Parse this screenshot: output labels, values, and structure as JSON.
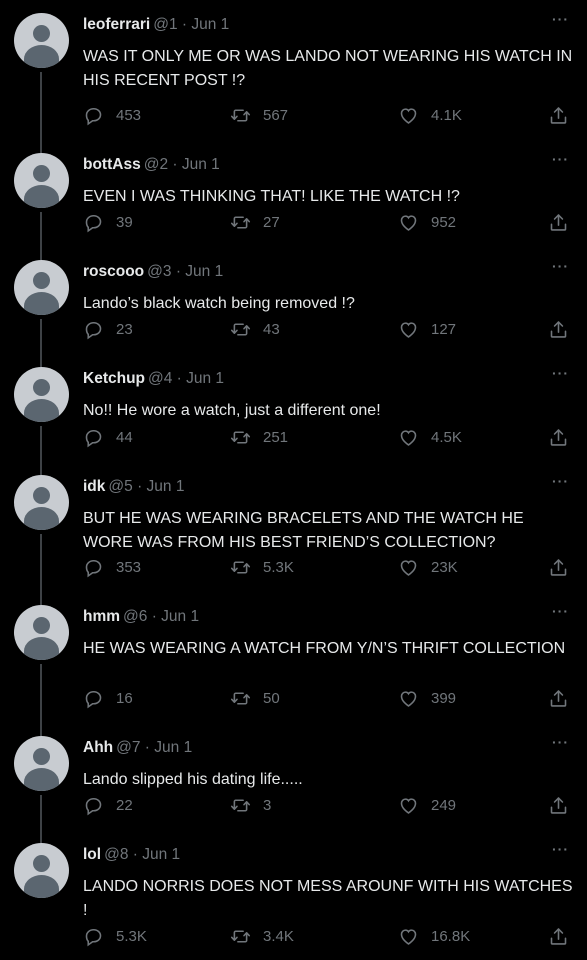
{
  "tweets": [
    {
      "name": "leoferrari",
      "meta": "@1 · Jun 1",
      "more": "···",
      "text": "WAS IT ONLY ME OR WAS LANDO NOT WEARING HIS WATCH IN HIS RECENT POST !?",
      "replies": "453",
      "retweets": "567",
      "likes": "4.1K"
    },
    {
      "name": "bottAss",
      "meta": "@2 · Jun 1",
      "more": "···",
      "text": "EVEN I WAS THINKING THAT! LIKE THE WATCH !?",
      "replies": "39",
      "retweets": "27",
      "likes": "952"
    },
    {
      "name": "roscooo",
      "meta": "@3 · Jun 1",
      "more": "···",
      "text": "Lando’s black watch being removed !?",
      "replies": "23",
      "retweets": "43",
      "likes": "127"
    },
    {
      "name": "Ketchup",
      "meta": "@4 · Jun 1",
      "more": "···",
      "text": "No!! He wore a watch, just a different one!",
      "replies": "44",
      "retweets": "251",
      "likes": "4.5K"
    },
    {
      "name": "idk",
      "meta": "@5 · Jun 1",
      "more": "···",
      "text": "BUT HE WAS WEARING BRACELETS AND THE WATCH HE WORE WAS FROM HIS BEST FRIEND’S COLLECTION?",
      "replies": "353",
      "retweets": "5.3K",
      "likes": "23K"
    },
    {
      "name": "hmm",
      "meta": "@6 · Jun 1",
      "more": "···",
      "text": "HE WAS WEARING A WATCH FROM Y/N’S THRIFT COLLECTION",
      "replies": "16",
      "retweets": "50",
      "likes": "399"
    },
    {
      "name": "Ahh",
      "meta": "@7 · Jun 1",
      "more": "···",
      "text": "Lando slipped his dating life.....",
      "replies": "22",
      "retweets": "3",
      "likes": "249"
    },
    {
      "name": "lol",
      "meta": "@8 · Jun 1",
      "more": "···",
      "text": "LANDO NORRIS DOES NOT MESS AROUNF WITH HIS WATCHES !",
      "replies": "5.3K",
      "retweets": "3.4K",
      "likes": "16.8K"
    }
  ],
  "icons": {
    "reply": "reply-icon",
    "retweet": "retweet-icon",
    "like": "heart-icon",
    "share": "share-icon",
    "more": "more-icon"
  },
  "colors": {
    "background": "#000000",
    "text": "#e7e9ea",
    "muted": "#71767b",
    "thread_line": "#3e4246"
  }
}
